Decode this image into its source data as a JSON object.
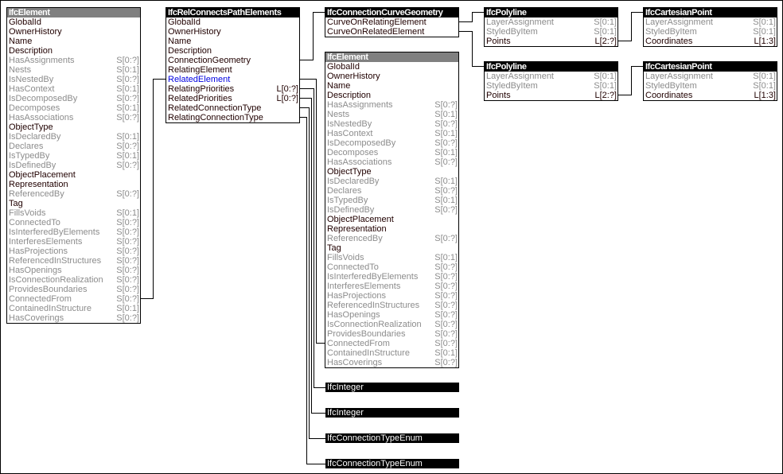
{
  "entities": {
    "ifc_element_left": {
      "title": "IfcElement",
      "header_style": "gray",
      "attributes": [
        {
          "name": "GlobalId",
          "card": "",
          "kind": "direct"
        },
        {
          "name": "OwnerHistory",
          "card": "",
          "kind": "direct"
        },
        {
          "name": "Name",
          "card": "",
          "kind": "direct"
        },
        {
          "name": "Description",
          "card": "",
          "kind": "direct"
        },
        {
          "name": "HasAssignments",
          "card": "S[0:?]",
          "kind": "inverse"
        },
        {
          "name": "Nests",
          "card": "S[0:1]",
          "kind": "inverse"
        },
        {
          "name": "IsNestedBy",
          "card": "S[0:?]",
          "kind": "inverse"
        },
        {
          "name": "HasContext",
          "card": "S[0:1]",
          "kind": "inverse"
        },
        {
          "name": "IsDecomposedBy",
          "card": "S[0:?]",
          "kind": "inverse"
        },
        {
          "name": "Decomposes",
          "card": "S[0:1]",
          "kind": "inverse"
        },
        {
          "name": "HasAssociations",
          "card": "S[0:?]",
          "kind": "inverse"
        },
        {
          "name": "ObjectType",
          "card": "",
          "kind": "direct"
        },
        {
          "name": "IsDeclaredBy",
          "card": "S[0:1]",
          "kind": "inverse"
        },
        {
          "name": "Declares",
          "card": "S[0:?]",
          "kind": "inverse"
        },
        {
          "name": "IsTypedBy",
          "card": "S[0:1]",
          "kind": "inverse"
        },
        {
          "name": "IsDefinedBy",
          "card": "S[0:?]",
          "kind": "inverse"
        },
        {
          "name": "ObjectPlacement",
          "card": "",
          "kind": "direct"
        },
        {
          "name": "Representation",
          "card": "",
          "kind": "direct"
        },
        {
          "name": "ReferencedBy",
          "card": "S[0:?]",
          "kind": "inverse"
        },
        {
          "name": "Tag",
          "card": "",
          "kind": "direct"
        },
        {
          "name": "FillsVoids",
          "card": "S[0:1]",
          "kind": "inverse"
        },
        {
          "name": "ConnectedTo",
          "card": "S[0:?]",
          "kind": "inverse"
        },
        {
          "name": "IsInterferedByElements",
          "card": "S[0:?]",
          "kind": "inverse"
        },
        {
          "name": "InterferesElements",
          "card": "S[0:?]",
          "kind": "inverse"
        },
        {
          "name": "HasProjections",
          "card": "S[0:?]",
          "kind": "inverse"
        },
        {
          "name": "ReferencedInStructures",
          "card": "S[0:?]",
          "kind": "inverse"
        },
        {
          "name": "HasOpenings",
          "card": "S[0:?]",
          "kind": "inverse"
        },
        {
          "name": "IsConnectionRealization",
          "card": "S[0:?]",
          "kind": "inverse"
        },
        {
          "name": "ProvidesBoundaries",
          "card": "S[0:?]",
          "kind": "inverse"
        },
        {
          "name": "ConnectedFrom",
          "card": "S[0:?]",
          "kind": "inverse"
        },
        {
          "name": "ContainedInStructure",
          "card": "S[0:1]",
          "kind": "inverse"
        },
        {
          "name": "HasCoverings",
          "card": "S[0:?]",
          "kind": "inverse"
        }
      ]
    },
    "ifc_rel_connects_path_elements": {
      "title": "IfcRelConnectsPathElements",
      "header_style": "dark",
      "attributes": [
        {
          "name": "GlobalId",
          "card": "",
          "kind": "direct"
        },
        {
          "name": "OwnerHistory",
          "card": "",
          "kind": "direct"
        },
        {
          "name": "Name",
          "card": "",
          "kind": "direct"
        },
        {
          "name": "Description",
          "card": "",
          "kind": "direct"
        },
        {
          "name": "ConnectionGeometry",
          "card": "",
          "kind": "direct"
        },
        {
          "name": "RelatingElement",
          "card": "",
          "kind": "direct"
        },
        {
          "name": "RelatedElement",
          "card": "",
          "kind": "selected"
        },
        {
          "name": "RelatingPriorities",
          "card": "L[0:?]",
          "kind": "direct"
        },
        {
          "name": "RelatedPriorities",
          "card": "L[0:?]",
          "kind": "direct"
        },
        {
          "name": "RelatedConnectionType",
          "card": "",
          "kind": "direct"
        },
        {
          "name": "RelatingConnectionType",
          "card": "",
          "kind": "direct"
        }
      ]
    },
    "ifc_connection_curve_geometry": {
      "title": "IfcConnectionCurveGeometry",
      "header_style": "dark",
      "attributes": [
        {
          "name": "CurveOnRelatingElement",
          "card": "",
          "kind": "direct"
        },
        {
          "name": "CurveOnRelatedElement",
          "card": "",
          "kind": "direct"
        }
      ]
    },
    "ifc_element_right": {
      "title": "IfcElement",
      "header_style": "gray",
      "attributes": [
        {
          "name": "GlobalId",
          "card": "",
          "kind": "direct"
        },
        {
          "name": "OwnerHistory",
          "card": "",
          "kind": "direct"
        },
        {
          "name": "Name",
          "card": "",
          "kind": "direct"
        },
        {
          "name": "Description",
          "card": "",
          "kind": "direct"
        },
        {
          "name": "HasAssignments",
          "card": "S[0:?]",
          "kind": "inverse"
        },
        {
          "name": "Nests",
          "card": "S[0:1]",
          "kind": "inverse"
        },
        {
          "name": "IsNestedBy",
          "card": "S[0:?]",
          "kind": "inverse"
        },
        {
          "name": "HasContext",
          "card": "S[0:1]",
          "kind": "inverse"
        },
        {
          "name": "IsDecomposedBy",
          "card": "S[0:?]",
          "kind": "inverse"
        },
        {
          "name": "Decomposes",
          "card": "S[0:1]",
          "kind": "inverse"
        },
        {
          "name": "HasAssociations",
          "card": "S[0:?]",
          "kind": "inverse"
        },
        {
          "name": "ObjectType",
          "card": "",
          "kind": "direct"
        },
        {
          "name": "IsDeclaredBy",
          "card": "S[0:1]",
          "kind": "inverse"
        },
        {
          "name": "Declares",
          "card": "S[0:?]",
          "kind": "inverse"
        },
        {
          "name": "IsTypedBy",
          "card": "S[0:1]",
          "kind": "inverse"
        },
        {
          "name": "IsDefinedBy",
          "card": "S[0:?]",
          "kind": "inverse"
        },
        {
          "name": "ObjectPlacement",
          "card": "",
          "kind": "direct"
        },
        {
          "name": "Representation",
          "card": "",
          "kind": "direct"
        },
        {
          "name": "ReferencedBy",
          "card": "S[0:?]",
          "kind": "inverse"
        },
        {
          "name": "Tag",
          "card": "",
          "kind": "direct"
        },
        {
          "name": "FillsVoids",
          "card": "S[0:1]",
          "kind": "inverse"
        },
        {
          "name": "ConnectedTo",
          "card": "S[0:?]",
          "kind": "inverse"
        },
        {
          "name": "IsInterferedByElements",
          "card": "S[0:?]",
          "kind": "inverse"
        },
        {
          "name": "InterferesElements",
          "card": "S[0:?]",
          "kind": "inverse"
        },
        {
          "name": "HasProjections",
          "card": "S[0:?]",
          "kind": "inverse"
        },
        {
          "name": "ReferencedInStructures",
          "card": "S[0:?]",
          "kind": "inverse"
        },
        {
          "name": "HasOpenings",
          "card": "S[0:?]",
          "kind": "inverse"
        },
        {
          "name": "IsConnectionRealization",
          "card": "S[0:?]",
          "kind": "inverse"
        },
        {
          "name": "ProvidesBoundaries",
          "card": "S[0:?]",
          "kind": "inverse"
        },
        {
          "name": "ConnectedFrom",
          "card": "S[0:?]",
          "kind": "inverse"
        },
        {
          "name": "ContainedInStructure",
          "card": "S[0:1]",
          "kind": "inverse"
        },
        {
          "name": "HasCoverings",
          "card": "S[0:?]",
          "kind": "inverse"
        }
      ]
    },
    "ifc_polyline_1": {
      "title": "IfcPolyline",
      "header_style": "dark",
      "attributes": [
        {
          "name": "LayerAssignment",
          "card": "S[0:1]",
          "kind": "inverse"
        },
        {
          "name": "StyledByItem",
          "card": "S[0:1]",
          "kind": "inverse"
        },
        {
          "name": "Points",
          "card": "L[2:?]",
          "kind": "direct"
        }
      ]
    },
    "ifc_polyline_2": {
      "title": "IfcPolyline",
      "header_style": "dark",
      "attributes": [
        {
          "name": "LayerAssignment",
          "card": "S[0:1]",
          "kind": "inverse"
        },
        {
          "name": "StyledByItem",
          "card": "S[0:1]",
          "kind": "inverse"
        },
        {
          "name": "Points",
          "card": "L[2:?]",
          "kind": "direct"
        }
      ]
    },
    "ifc_cartesian_point_1": {
      "title": "IfcCartesianPoint",
      "header_style": "dark",
      "attributes": [
        {
          "name": "LayerAssignment",
          "card": "S[0:1]",
          "kind": "inverse"
        },
        {
          "name": "StyledByItem",
          "card": "S[0:1]",
          "kind": "inverse"
        },
        {
          "name": "Coordinates",
          "card": "L[1:3]",
          "kind": "direct"
        }
      ]
    },
    "ifc_cartesian_point_2": {
      "title": "IfcCartesianPoint",
      "header_style": "dark",
      "attributes": [
        {
          "name": "LayerAssignment",
          "card": "S[0:1]",
          "kind": "inverse"
        },
        {
          "name": "StyledByItem",
          "card": "S[0:1]",
          "kind": "inverse"
        },
        {
          "name": "Coordinates",
          "card": "L[1:3]",
          "kind": "direct"
        }
      ]
    }
  },
  "types": {
    "relating_priorities_type": "IfcInteger",
    "related_priorities_type": "IfcInteger",
    "related_connection_type": "IfcConnectionTypeEnum",
    "relating_connection_type": "IfcConnectionTypeEnum"
  },
  "colors": {
    "direct_text": "#200000",
    "inverse_text": "#8c8c8c",
    "selected_text": "#0000e0",
    "header_dark": "#000000",
    "header_gray": "#808080"
  }
}
